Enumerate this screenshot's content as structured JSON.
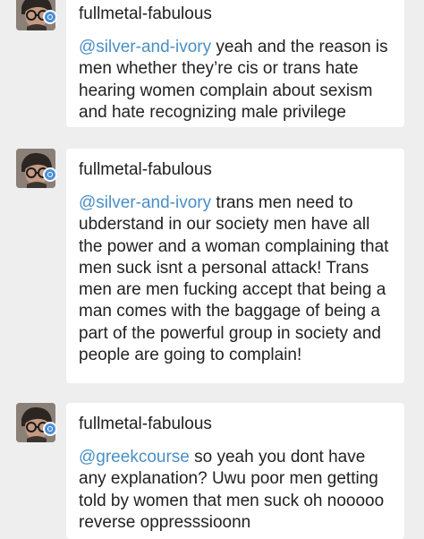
{
  "colors": {
    "background": "#eeeeee",
    "bubble": "#ffffff",
    "mention": "#4a8fc6",
    "badge": "#4a90d9"
  },
  "messages": [
    {
      "username": "fullmetal-fabulous",
      "mention": "@silver-and-ivory",
      "text": " yeah and the reason is men whether they’re cis or trans hate hearing women complain about sexism and hate recognizing male privilege",
      "avatar_icon": "user-avatar-icon",
      "badge_icon": "chat-badge-icon"
    },
    {
      "username": "fullmetal-fabulous",
      "mention": "@silver-and-ivory",
      "text": " trans men need to ubderstand in our society men have all the power and a woman complaining that men suck isnt a personal attack! Trans men are men fucking accept that being a man comes with the baggage of being a part of the powerful group in society and people are going to complain!",
      "avatar_icon": "user-avatar-icon",
      "badge_icon": "chat-badge-icon"
    },
    {
      "username": "fullmetal-fabulous",
      "mention": "@greekcourse",
      "text": " so yeah you dont have any explanation? Uwu poor men getting told by women that men suck oh nooooo reverse oppresssioonn",
      "avatar_icon": "user-avatar-icon",
      "badge_icon": "chat-badge-icon"
    }
  ]
}
